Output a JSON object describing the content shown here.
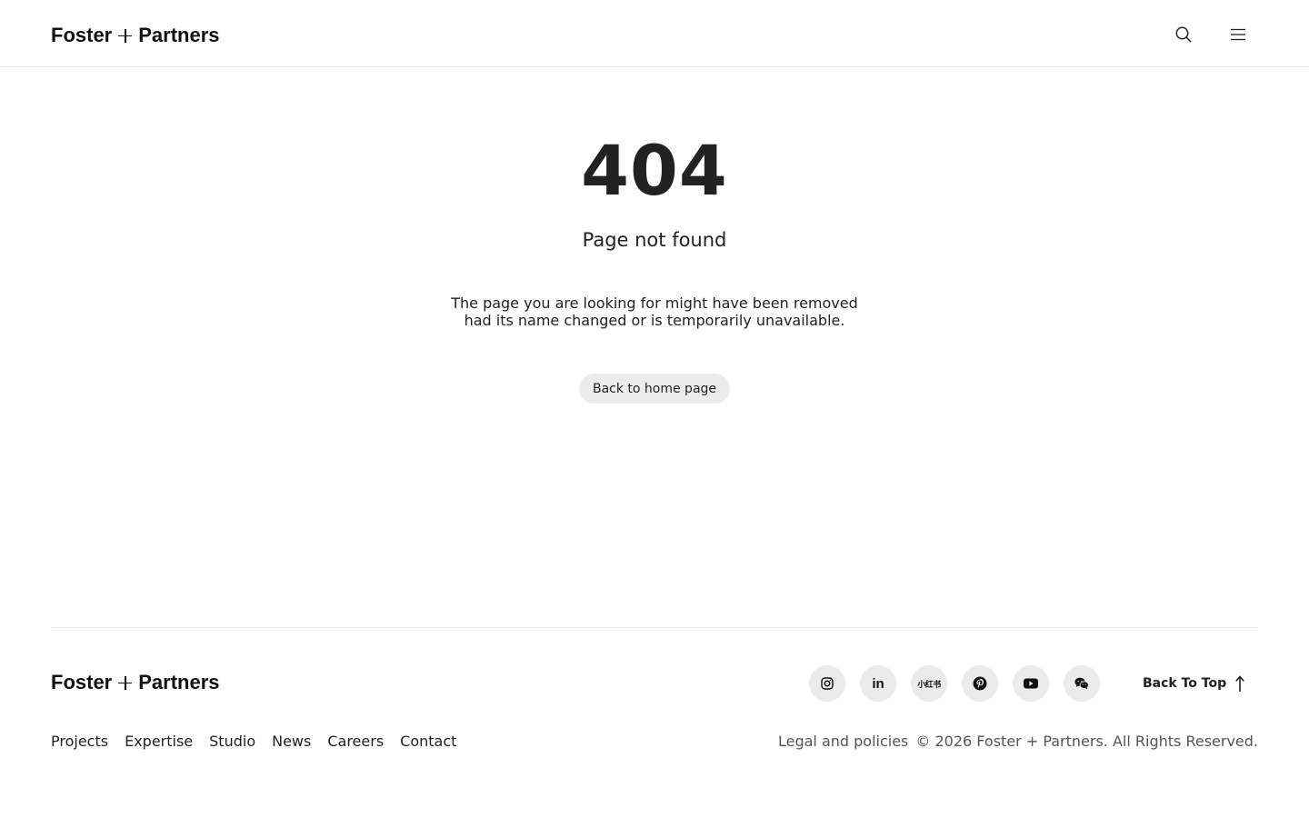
{
  "header": {
    "logo": {
      "left": "Foster",
      "right": "Partners"
    },
    "search_icon": "search-icon",
    "menu_icon": "hamburger-menu-icon"
  },
  "main": {
    "code": "404",
    "title": "Page not found",
    "message_line1": "The page you are looking for might have been removed",
    "message_line2": "had its name changed or is temporarily unavailable.",
    "home_button": "Back to home page"
  },
  "footer": {
    "logo": {
      "left": "Foster",
      "right": "Partners"
    },
    "social": [
      {
        "icon": "instagram-icon"
      },
      {
        "icon": "linkedin-icon",
        "label": "in"
      },
      {
        "icon": "xiaohongshu-icon",
        "label": "小红书"
      },
      {
        "icon": "pinterest-icon"
      },
      {
        "icon": "youtube-icon"
      },
      {
        "icon": "wechat-icon"
      }
    ],
    "back_to_top": "Back To Top",
    "nav": [
      "Projects",
      "Expertise",
      "Studio",
      "News",
      "Careers",
      "Contact"
    ],
    "legal": "Legal and policies",
    "copyright": "© 2026 Foster + Partners. All Rights Reserved."
  }
}
